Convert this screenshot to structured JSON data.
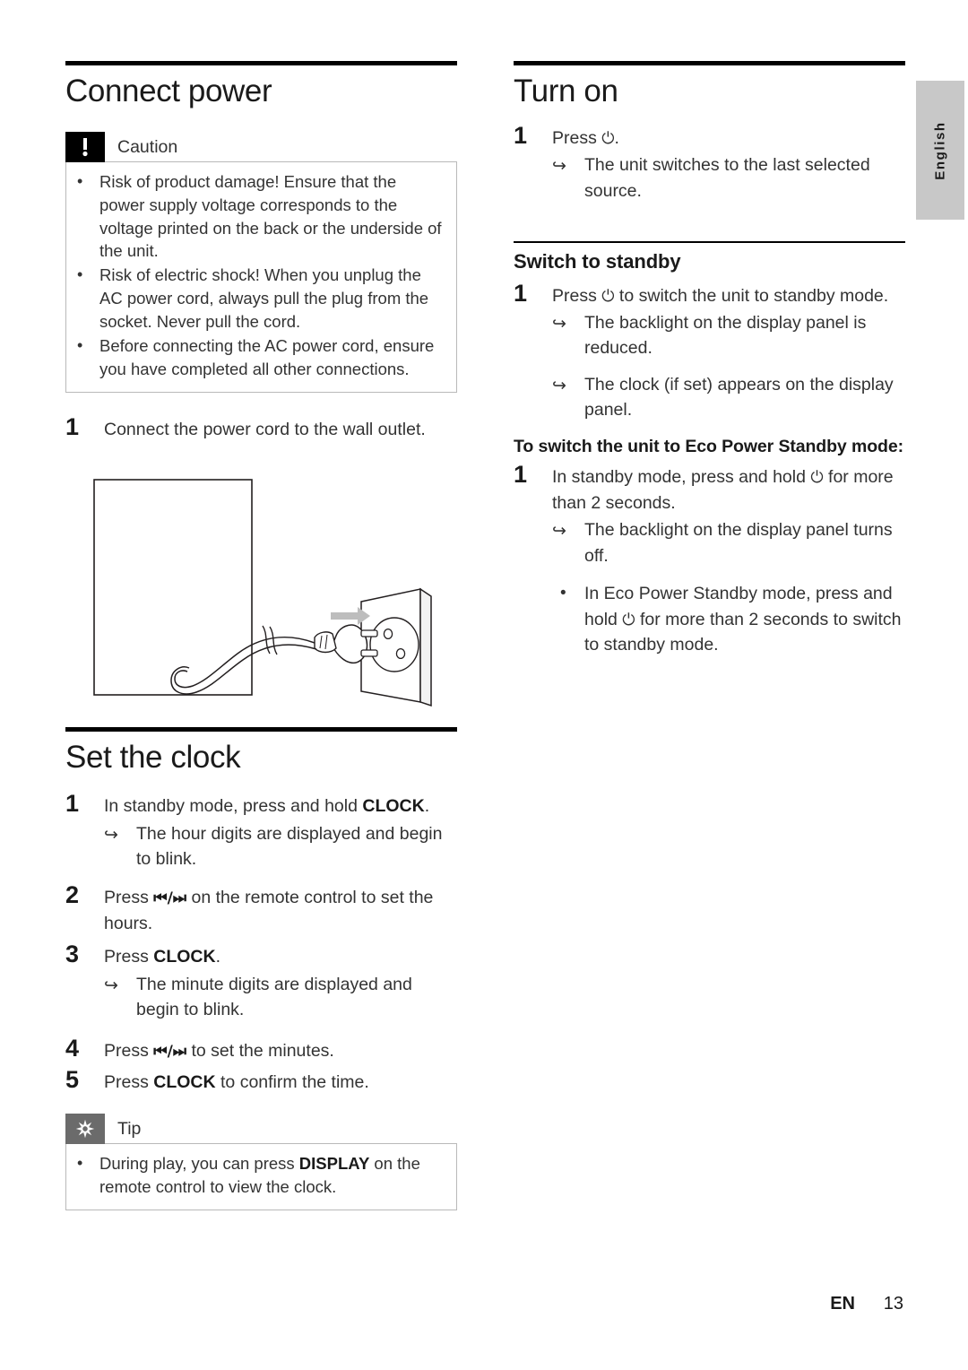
{
  "document": {
    "language_tab": "English",
    "footer": {
      "lang_code": "EN",
      "page_number": "13"
    }
  },
  "left_column": {
    "section_title": "Connect power",
    "caution": {
      "label": "Caution",
      "icon": "exclamation-icon",
      "items": [
        "Risk of product damage! Ensure that the power supply voltage corresponds to the voltage printed on the back or the underside of the unit.",
        "Risk of electric shock! When you unplug the AC power cord, always pull the plug from the socket. Never pull the cord.",
        "Before connecting the AC power cord, ensure you have completed all other connections."
      ]
    },
    "step_1": {
      "number": "1",
      "text": "Connect the power cord to the wall outlet."
    },
    "illustration": {
      "name": "power-cord-to-wall-outlet-illustration",
      "elements": [
        "unit-outline",
        "power-cord",
        "plug",
        "wall-socket",
        "direction-arrow"
      ]
    },
    "clock_section": {
      "section_title": "Set the clock",
      "steps": [
        {
          "number": "1",
          "text_before": "In standby mode, press and hold ",
          "bold": "CLOCK",
          "text_after": ".",
          "results": [
            "The hour digits are displayed and begin to blink."
          ]
        },
        {
          "number": "2",
          "text_before": "Press ",
          "symbol": "⏮/⏭",
          "text_after": " on the remote control to set the hours.",
          "results": []
        },
        {
          "number": "3",
          "text_before": "Press ",
          "bold": "CLOCK",
          "text_after": ".",
          "results": [
            "The minute digits are displayed and begin to blink."
          ]
        },
        {
          "number": "4",
          "text_before": "Press ",
          "symbol": "⏮/⏭",
          "text_after": " to set the minutes.",
          "results": []
        },
        {
          "number": "5",
          "text_before": "Press ",
          "bold": "CLOCK",
          "text_after": " to confirm the time.",
          "results": []
        }
      ],
      "tip": {
        "label": "Tip",
        "icon": "starburst-icon",
        "item_before": "During play, you can press ",
        "item_bold": "DISPLAY",
        "item_after": " on the remote control to view the clock."
      }
    }
  },
  "right_column": {
    "turn_on": {
      "section_title": "Turn on",
      "step": {
        "number": "1",
        "text_before": "Press ",
        "symbol": "⏻",
        "text_after": ".",
        "results": [
          "The unit switches to the last selected source."
        ]
      }
    },
    "standby": {
      "sub_title": "Switch to standby",
      "step": {
        "number": "1",
        "text_before": "Press ",
        "symbol": "⏻",
        "text_after": " to switch the unit to standby mode.",
        "results": [
          "The backlight on the display panel is reduced.",
          "The clock (if set) appears on the display panel."
        ]
      },
      "eco_heading": "To switch the unit to Eco Power Standby mode:",
      "eco_step": {
        "number": "1",
        "text_before": "In standby mode, press and hold ",
        "symbol": "⏻",
        "text_after": " for more than 2 seconds.",
        "results": [
          "The backlight on the display panel turns off."
        ]
      },
      "eco_bullet": {
        "text_before": "In Eco Power Standby mode, press and hold ",
        "symbol": "⏻",
        "text_after": " for more than 2 seconds to switch to standby mode."
      }
    }
  },
  "glyphs": {
    "result_arrow": "↪",
    "bullet": "•"
  },
  "colors": {
    "text": "#333333",
    "heading": "#1a1a1a",
    "caution_icon_bg": "#000000",
    "tip_icon_bg": "#6b6b6b",
    "note_border": "#b9b9b9",
    "lang_tab_bg": "#c8c8c8"
  }
}
